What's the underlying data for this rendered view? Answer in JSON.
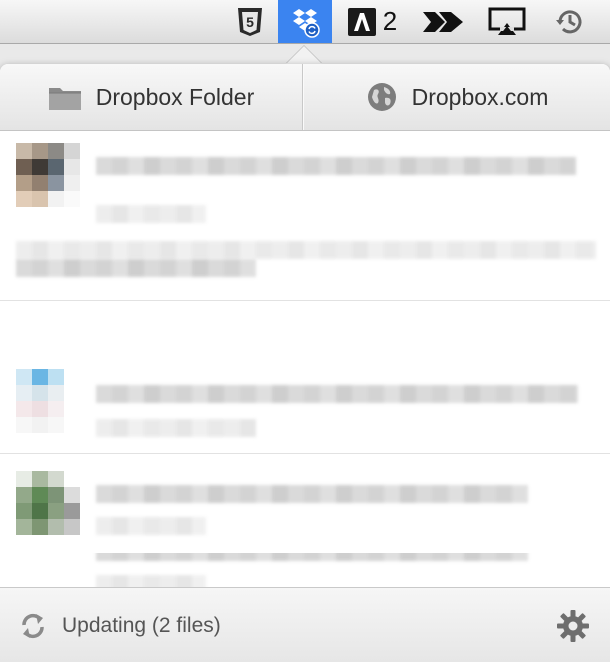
{
  "menubar": {
    "icons": [
      "html5-shield-icon",
      "dropbox-icon",
      "adobe-icon",
      "rush-chevrons-icon",
      "airplay-icon",
      "time-machine-icon"
    ],
    "adobe_count": "2",
    "dropbox_active_color": "#3b84f0"
  },
  "header": {
    "folder_label": "Dropbox Folder",
    "web_label": "Dropbox.com"
  },
  "footer": {
    "status_label": "Updating (2 files)"
  },
  "colors": {
    "accent": "#3b84f0",
    "text": "#333333",
    "status_text": "#555555"
  }
}
